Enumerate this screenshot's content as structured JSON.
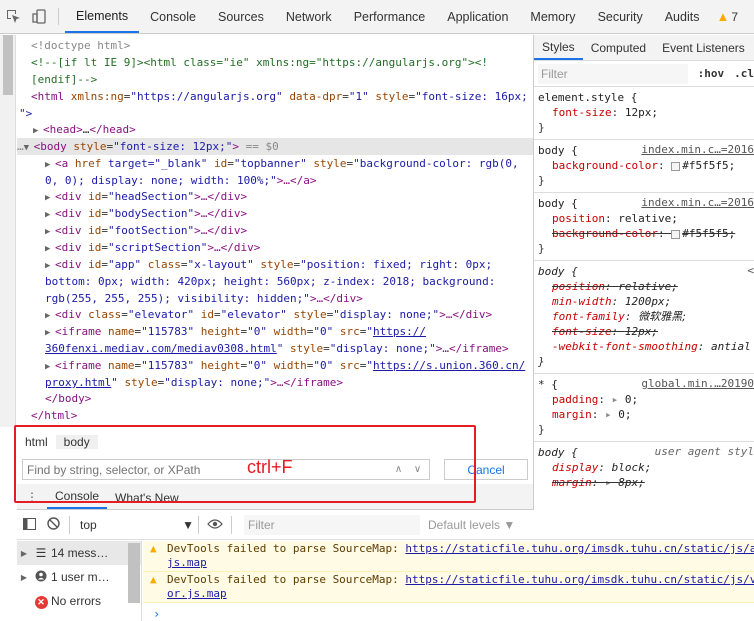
{
  "topbar": {
    "tabs": [
      "Elements",
      "Console",
      "Sources",
      "Network",
      "Performance",
      "Application",
      "Memory",
      "Security",
      "Audits"
    ],
    "active_tab": "Elements",
    "warning_count": "7"
  },
  "dom": {
    "lines": {
      "l1": "<!doctype html>",
      "l2": "<!--[if lt IE 9]><html class=\"ie\" xmlns:ng=\"https://angularjs.org\"><!",
      "l3": "[endif]-->",
      "l4_tag": "<html",
      "l4_a1": "xmlns:ng",
      "l4_v1": "\"https://angularjs.org\"",
      "l4_a2": "data-dpr",
      "l4_v2": "\"1\"",
      "l4_a3": "style",
      "l4_v3": "\"font-size: 16px;",
      "l5": "\">",
      "l6_open": "<head>",
      "l6_mid": "…",
      "l6_close": "</head>",
      "l7_tag": "<body",
      "l7_a": "style",
      "l7_v": "\"font-size: 12px;\"",
      "l7_ref": "== $0",
      "l8_tag": "<a",
      "l8_a1": "href",
      "l8_v1": "target=\"_blank\"",
      "l8_a2": "id",
      "l8_v2": "\"topbanner\"",
      "l8_a3": "style",
      "l8_v3": "\"background-color: rgb(0,",
      "l9_v": "0, 0); display: none; width: 100%;\"",
      "l9_rest": ">…</a>",
      "l10": "headSection",
      "l11": "bodySection",
      "l12": "footSection",
      "l13": "scriptSection",
      "l14_id": "\"app\"",
      "l14_class": "\"x-layout\"",
      "l14_style": "\"position: fixed; right: 0px;",
      "l15": "bottom: 0px; width: 420px; height: 560px; z-index: 2018; background:",
      "l16": "rgb(255, 255, 255); visibility: hidden;\"",
      "l16_rest": ">…</div>",
      "l17_class": "\"elevator\"",
      "l17_id": "\"elevator\"",
      "l17_style": "\"display: none;\"",
      "l17_rest": ">…</div>",
      "l18_name": "\"115783\"",
      "l18_h": "\"0\"",
      "l18_w": "\"0\"",
      "l18_src": "https://",
      "l19_link": "360fenxi.mediav.com/mediav0308.html",
      "l19_style": "\"display: none;\"",
      "l19_rest": ">…</iframe>",
      "l20_name": "\"115783\"",
      "l20_h": "\"0\"",
      "l20_w": "\"0\"",
      "l20_src": "https://s.union.360.cn/",
      "l21_link": "proxy.html",
      "l21_style": "\"display: none;\"",
      "l21_rest": ">…</iframe>",
      "l22": "</body>",
      "l23": "</html>"
    }
  },
  "breadcrumb": [
    "html",
    "body"
  ],
  "find": {
    "placeholder": "Find by string, selector, or XPath",
    "cancel_label": "Cancel",
    "annotation": "ctrl+F"
  },
  "drawer": {
    "tabs": [
      "Console",
      "What's New"
    ]
  },
  "styles": {
    "tabs": [
      "Styles",
      "Computed",
      "Event Listeners"
    ],
    "filter_placeholder": "Filter",
    "hov": ":hov",
    "cls": ".cl",
    "rules": {
      "r1_sel": "element.style {",
      "r1_p": "font-size",
      "r1_v": "12px;",
      "r2_sel": "body {",
      "r2_src": "index.min.c…=2016",
      "r2_p": "background-color",
      "r2_v": "#f5f5f5;",
      "r3_sel": "body {",
      "r3_src": "index.min.c…=2016",
      "r3_p1": "position",
      "r3_v1": "relative;",
      "r3_p2": "background-color",
      "r3_v2": "#f5f5f5;",
      "r4_sel": "body {",
      "r4_src": "<",
      "r4_p1": "position",
      "r4_v1": "relative;",
      "r4_p2": "min-width",
      "r4_v2": "1200px;",
      "r4_p3": "font-family",
      "r4_v3": "微软雅黑;",
      "r4_p4": "font-size",
      "r4_v4": "12px;",
      "r4_p5": "-webkit-font-smoothing",
      "r4_v5": "antial",
      "r5_sel": "* {",
      "r5_src": "global.min.…20190",
      "r5_p1": "padding",
      "r5_v1": "0;",
      "r5_p2": "margin",
      "r5_v2": "0;",
      "r6_sel": "body {",
      "r6_src": "user agent styl",
      "r6_p1": "display",
      "r6_v1": "block;",
      "r6_p2": "margin",
      "r6_v2": "8px;"
    },
    "close_brace": "}"
  },
  "console_toolbar": {
    "context": "top",
    "filter_placeholder": "Filter",
    "levels": "Default levels ▼"
  },
  "console_sidebar": {
    "items": [
      "14 mess…",
      "1 user m…",
      "No errors"
    ]
  },
  "console_messages": {
    "m1_text": "DevTools failed to parse SourceMap: ",
    "m1_link": "https://staticfile.tuhu.org/imsdk.tuhu.cn/static/js/a",
    "m1_link2": "js.map",
    "m2_text": "DevTools failed to parse SourceMap: ",
    "m2_link": "https://staticfile.tuhu.org/imsdk.tuhu.cn/static/js/v",
    "m2_link2": "or.js.map"
  },
  "colors": {
    "accent": "#1a73e8",
    "annotation_red": "#e51c23",
    "warning_bg": "#fffbe5"
  }
}
